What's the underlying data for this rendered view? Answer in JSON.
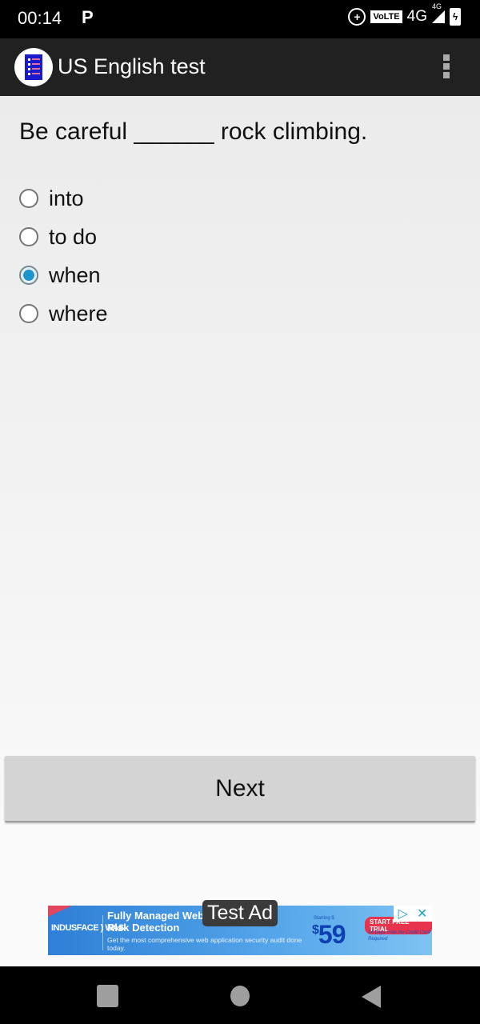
{
  "status_bar": {
    "time": "00:14",
    "notification_icon": "P",
    "volte": "VoLTE",
    "network": "4G",
    "signal_network": "4G",
    "battery_icon": "charging-battery"
  },
  "app_bar": {
    "title": "US English test",
    "logo_icon": "document-list-icon",
    "menu_icon": "overflow-menu-icon"
  },
  "question": {
    "text": "Be careful ______ rock climbing."
  },
  "options": [
    {
      "label": "into",
      "checked": false
    },
    {
      "label": "to do",
      "checked": false
    },
    {
      "label": "when",
      "checked": true
    },
    {
      "label": "where",
      "checked": false
    }
  ],
  "next_button": {
    "label": "Next"
  },
  "ad": {
    "overlay_label": "Test Ad",
    "brand": "INDUSFACE ) WAS",
    "headline": "Fully Managed Web Risk Detection",
    "subtext": "Get the most comprehensive web application security audit done today.",
    "price_prefix": "Starting $",
    "price_symbol": "$",
    "price": "59",
    "cta": "START FREE TRIAL",
    "note": "14 Days Free No Credit Card Required",
    "adchoices_icon": "▷",
    "close_icon": "✕"
  },
  "nav_bar": {
    "recent": "recent-apps",
    "home": "home",
    "back": "back"
  }
}
